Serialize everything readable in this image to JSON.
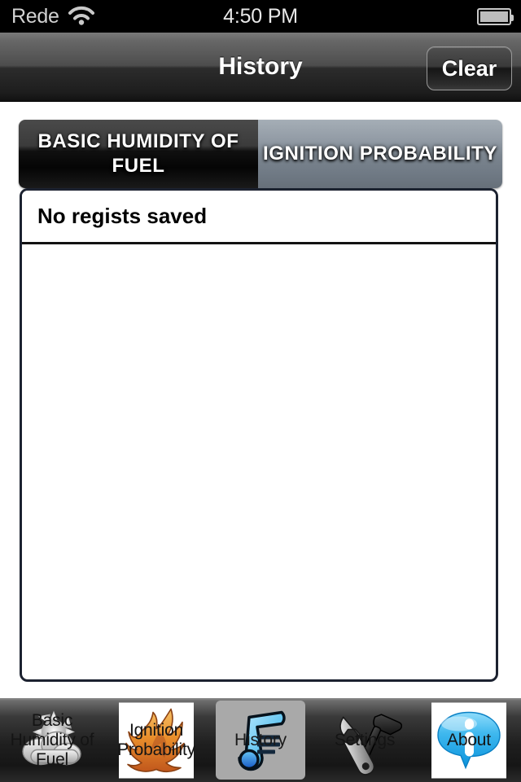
{
  "status_bar": {
    "carrier": "Rede",
    "wifi_icon": "wifi-icon",
    "time": "4:50 PM",
    "battery_icon": "battery-full-icon"
  },
  "nav_bar": {
    "title": "History",
    "clear_label": "Clear"
  },
  "segmented_control": {
    "selected_index": 1,
    "segments": [
      {
        "label": "BASIC HUMIDITY OF FUEL"
      },
      {
        "label": "IGNITION PROBABILITY"
      }
    ]
  },
  "content": {
    "rows": [
      {
        "label": "No regists saved"
      }
    ]
  },
  "tab_bar": {
    "selected_index": 2,
    "tabs": [
      {
        "label": "Basic Humidity of Fuel",
        "icon": "sun-cloud-icon"
      },
      {
        "label": "Ignition Probability",
        "icon": "flame-icon"
      },
      {
        "label": "History",
        "icon": "scroll-document-icon"
      },
      {
        "label": "Settings",
        "icon": "wrench-hammer-icon"
      },
      {
        "label": "About",
        "icon": "info-bubble-icon"
      }
    ]
  },
  "colors": {
    "status_bar_bg": "#000000",
    "nav_bar_top": "#7a7a7a",
    "nav_bar_bottom": "#111111",
    "segment_selected": "#8b949e",
    "segment_unselected": "#0a0a0a",
    "panel_border": "#1c2230",
    "panel_bg": "#ffffff",
    "tab_selected_bg": "#a9a9a9",
    "flame_orange": "#e8912e",
    "info_blue": "#29b6e8"
  }
}
